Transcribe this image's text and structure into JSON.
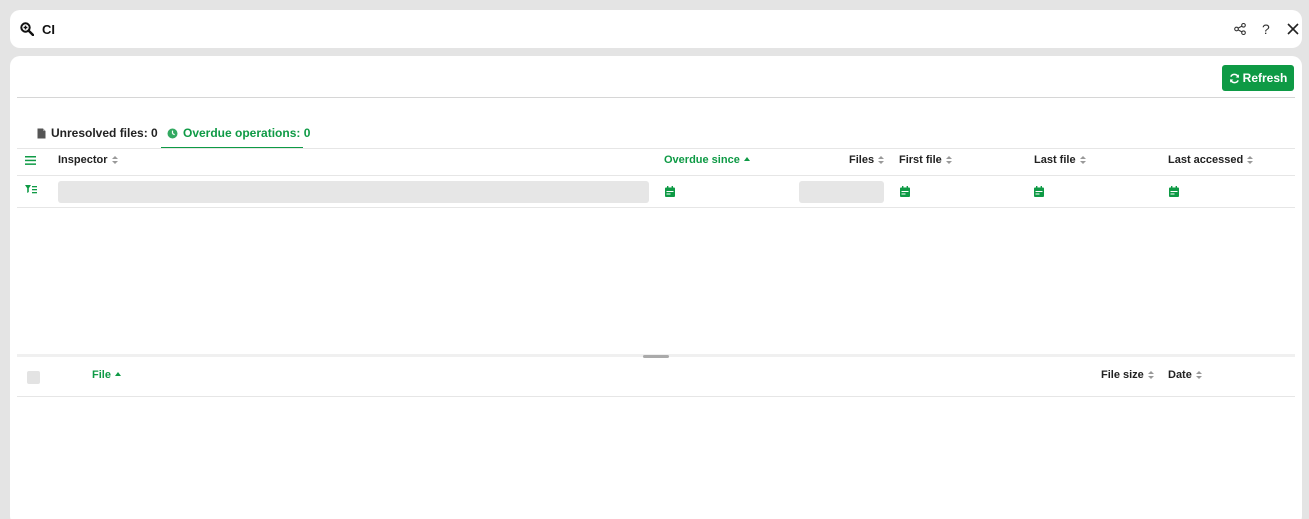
{
  "header": {
    "title": "CI",
    "help_label": "?"
  },
  "toolbar": {
    "refresh_label": "Refresh"
  },
  "tabs": [
    {
      "label": "Unresolved files: 0",
      "icon": "file-icon",
      "active": false
    },
    {
      "label": "Overdue operations: 0",
      "icon": "clock-icon",
      "active": true
    }
  ],
  "operations_table": {
    "columns": [
      {
        "label": "Inspector",
        "sort": "none"
      },
      {
        "label": "Overdue since",
        "sort": "asc"
      },
      {
        "label": "Files",
        "sort": "none"
      },
      {
        "label": "First file",
        "sort": "none"
      },
      {
        "label": "Last file",
        "sort": "none"
      },
      {
        "label": "Last accessed",
        "sort": "none"
      }
    ],
    "rows": []
  },
  "files_table": {
    "columns": [
      {
        "label": "File",
        "sort": "asc"
      },
      {
        "label": "File size",
        "sort": "none"
      },
      {
        "label": "Date",
        "sort": "none"
      }
    ],
    "rows": []
  },
  "colors": {
    "accent": "#0e9a45",
    "background": "#e4e4e4",
    "panel": "#ffffff"
  }
}
